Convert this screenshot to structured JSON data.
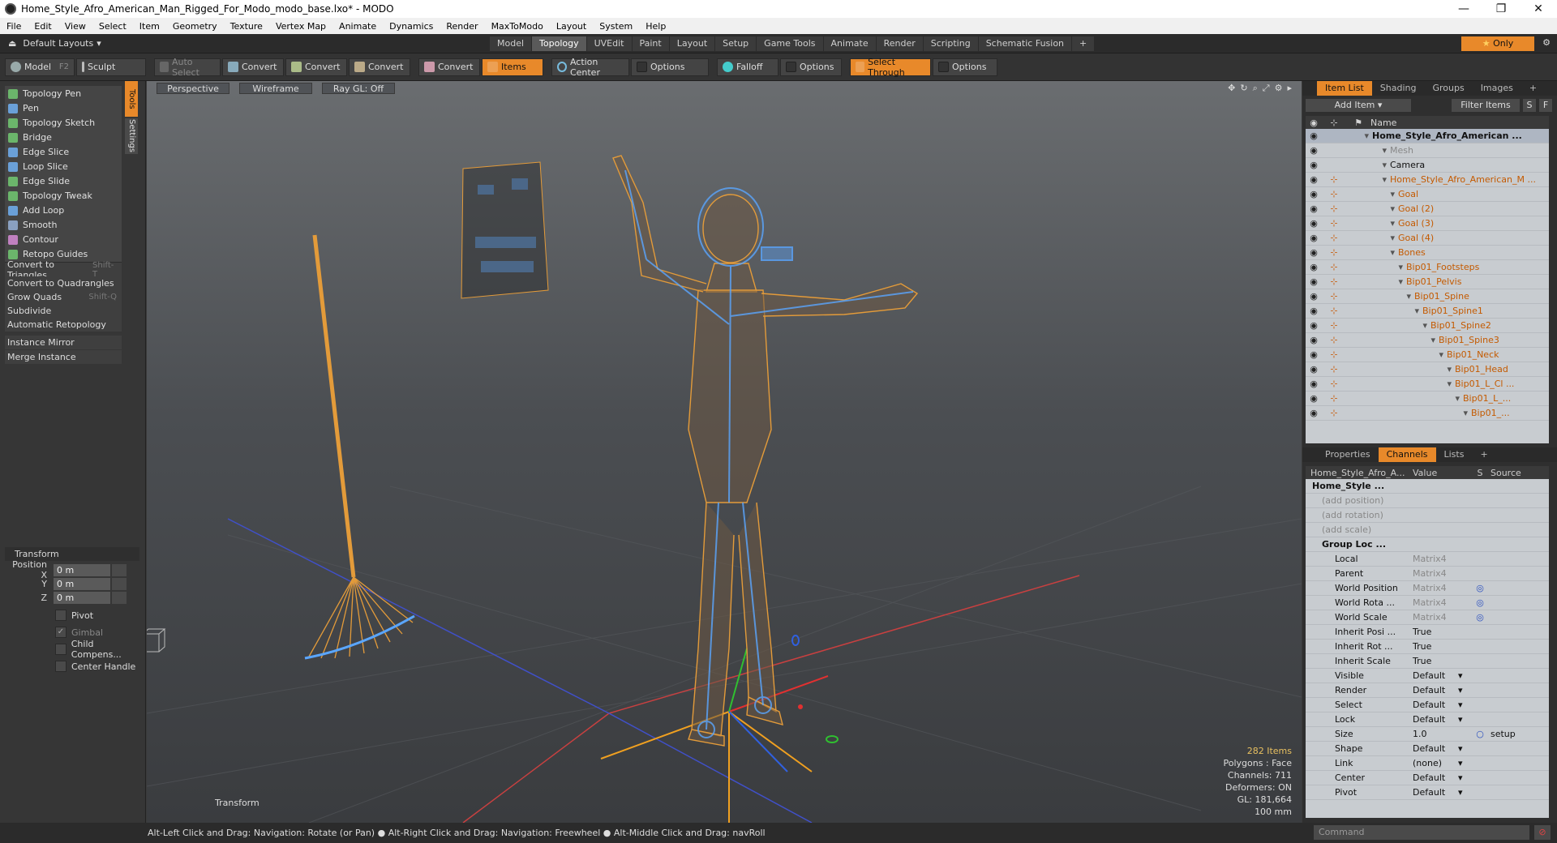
{
  "window": {
    "title": "Home_Style_Afro_American_Man_Rigged_For_Modo_modo_base.lxo* - MODO",
    "min": "—",
    "max": "❐",
    "close": "✕"
  },
  "menu": [
    "File",
    "Edit",
    "View",
    "Select",
    "Item",
    "Geometry",
    "Texture",
    "Vertex Map",
    "Animate",
    "Dynamics",
    "Render",
    "MaxToModo",
    "Layout",
    "System",
    "Help"
  ],
  "layouts": {
    "default_label": "Default Layouts",
    "tabs": [
      "Model",
      "Topology",
      "UVEdit",
      "Paint",
      "Layout",
      "Setup",
      "Game Tools",
      "Animate",
      "Render",
      "Scripting",
      "Schematic Fusion"
    ],
    "active_tab": "Topology",
    "only_label": "Only"
  },
  "toolbar": {
    "mode_model": "Model",
    "mode_key": "F2",
    "mode_sculpt": "Sculpt",
    "auto_select": "Auto Select",
    "convert1": "Convert",
    "convert2": "Convert",
    "convert3": "Convert",
    "convert4": "Convert",
    "items": "Items",
    "action_center": "Action Center",
    "options1": "Options",
    "falloff": "Falloff",
    "options2": "Options",
    "select_through": "Select Through",
    "options3": "Options"
  },
  "left_tabs": {
    "tools": "Tools",
    "settings": "Settings"
  },
  "tools": [
    {
      "label": "Topology Pen",
      "color": "#6bb56b"
    },
    {
      "label": "Pen",
      "color": "#6aa0d8"
    },
    {
      "label": "Topology Sketch",
      "color": "#6bb56b"
    },
    {
      "label": "Bridge",
      "color": "#6bb56b"
    },
    {
      "label": "Edge Slice",
      "color": "#6aa0d8"
    },
    {
      "label": "Loop Slice",
      "color": "#6aa0d8"
    },
    {
      "label": "Edge Slide",
      "color": "#6bb56b"
    },
    {
      "label": "Topology Tweak",
      "color": "#6bb56b"
    },
    {
      "label": "Add Loop",
      "color": "#6aa0d8"
    },
    {
      "label": "Smooth",
      "color": "#8aa0c0"
    },
    {
      "label": "Contour",
      "color": "#c080c0"
    },
    {
      "label": "Retopo Guides",
      "color": "#6bb56b"
    }
  ],
  "commands": [
    {
      "label": "Convert to Triangles",
      "shortcut": "Shift-T"
    },
    {
      "label": "Convert to Quadrangles",
      "shortcut": ""
    },
    {
      "label": "Grow Quads",
      "shortcut": "Shift-Q"
    },
    {
      "label": "Subdivide",
      "shortcut": ""
    },
    {
      "label": "Automatic Retopology",
      "shortcut": ""
    }
  ],
  "instance_commands": [
    "Instance Mirror",
    "Merge Instance"
  ],
  "transform": {
    "header": "Transform",
    "pos_x_label": "Position X",
    "y_label": "Y",
    "z_label": "Z",
    "x": "0 m",
    "y": "0 m",
    "z": "0 m",
    "pivot": "Pivot",
    "gimbal": "Gimbal",
    "child_comp": "Child Compens...",
    "center_handle": "Center Handle"
  },
  "viewport": {
    "perspective": "Perspective",
    "wireframe": "Wireframe",
    "raygl": "Ray GL: Off",
    "label": "Transform",
    "stats": {
      "items": "282 Items",
      "polygons": "Polygons : Face",
      "channels": "Channels: 711",
      "deformers": "Deformers: ON",
      "gl": "GL: 181,664",
      "scale": "100 mm"
    }
  },
  "item_panel": {
    "tabs": [
      "Item List",
      "Shading",
      "Groups",
      "Images"
    ],
    "add_item": "Add Item",
    "filter_items": "Filter Items",
    "s": "S",
    "f": "F",
    "col_name": "Name",
    "rows": [
      {
        "indent": 68,
        "name": "Home_Style_Afro_American ...",
        "style": "sel",
        "lock": ""
      },
      {
        "indent": 90,
        "name": "Mesh",
        "style": "grey",
        "lock": ""
      },
      {
        "indent": 90,
        "name": "Camera",
        "style": "",
        "lock": ""
      },
      {
        "indent": 90,
        "name": "Home_Style_Afro_American_M ...",
        "style": "orange",
        "lock": "⊹"
      },
      {
        "indent": 100,
        "name": "Goal",
        "style": "orange",
        "lock": "⊹"
      },
      {
        "indent": 100,
        "name": "Goal (2)",
        "style": "orange",
        "lock": "⊹"
      },
      {
        "indent": 100,
        "name": "Goal (3)",
        "style": "orange",
        "lock": "⊹"
      },
      {
        "indent": 100,
        "name": "Goal (4)",
        "style": "orange",
        "lock": "⊹"
      },
      {
        "indent": 100,
        "name": "Bones",
        "style": "orange",
        "lock": "⊹"
      },
      {
        "indent": 110,
        "name": "Bip01_Footsteps",
        "style": "orange",
        "lock": "⊹"
      },
      {
        "indent": 110,
        "name": "Bip01_Pelvis",
        "style": "orange",
        "lock": "⊹"
      },
      {
        "indent": 120,
        "name": "Bip01_Spine",
        "style": "orange",
        "lock": "⊹"
      },
      {
        "indent": 130,
        "name": "Bip01_Spine1",
        "style": "orange",
        "lock": "⊹"
      },
      {
        "indent": 140,
        "name": "Bip01_Spine2",
        "style": "orange",
        "lock": "⊹"
      },
      {
        "indent": 150,
        "name": "Bip01_Spine3",
        "style": "orange",
        "lock": "⊹"
      },
      {
        "indent": 160,
        "name": "Bip01_Neck",
        "style": "orange",
        "lock": "⊹"
      },
      {
        "indent": 170,
        "name": "Bip01_Head",
        "style": "orange",
        "lock": "⊹"
      },
      {
        "indent": 170,
        "name": "Bip01_L_Cl ...",
        "style": "orange",
        "lock": "⊹"
      },
      {
        "indent": 180,
        "name": "Bip01_L_...",
        "style": "orange",
        "lock": "⊹"
      },
      {
        "indent": 190,
        "name": "Bip01_...",
        "style": "orange",
        "lock": "⊹"
      }
    ]
  },
  "channel_panel": {
    "tabs": [
      "Properties",
      "Channels",
      "Lists"
    ],
    "col_name": "Home_Style_Afro_A...",
    "col_value": "Value",
    "col_s": "S",
    "col_source": "Source",
    "rows": [
      {
        "name": "Home_Style ...",
        "value": "",
        "s": "",
        "source": "",
        "style": "bold",
        "indent": 8
      },
      {
        "name": "(add position)",
        "value": "",
        "s": "",
        "source": "",
        "style": "grey",
        "indent": 20
      },
      {
        "name": "(add rotation)",
        "value": "",
        "s": "",
        "source": "",
        "style": "grey",
        "indent": 20
      },
      {
        "name": "(add scale)",
        "value": "",
        "s": "",
        "source": "",
        "style": "grey",
        "indent": 20
      },
      {
        "name": "Group Loc ...",
        "value": "",
        "s": "",
        "source": "",
        "style": "bold",
        "indent": 20
      },
      {
        "name": "Local",
        "value": "Matrix4",
        "s": "",
        "source": "",
        "style": "dimv",
        "indent": 36
      },
      {
        "name": "Parent",
        "value": "Matrix4",
        "s": "",
        "source": "",
        "style": "dimv",
        "indent": 36
      },
      {
        "name": "World Position",
        "value": "Matrix4",
        "s": "◎",
        "source": "",
        "style": "dimv",
        "indent": 36
      },
      {
        "name": "World Rota ...",
        "value": "Matrix4",
        "s": "◎",
        "source": "",
        "style": "dimv",
        "indent": 36
      },
      {
        "name": "World Scale",
        "value": "Matrix4",
        "s": "◎",
        "source": "",
        "style": "dimv",
        "indent": 36
      },
      {
        "name": "Inherit Posi ...",
        "value": "True",
        "s": "",
        "source": "",
        "style": "",
        "indent": 36
      },
      {
        "name": "Inherit Rot ...",
        "value": "True",
        "s": "",
        "source": "",
        "style": "",
        "indent": 36
      },
      {
        "name": "Inherit Scale",
        "value": "True",
        "s": "",
        "source": "",
        "style": "",
        "indent": 36
      },
      {
        "name": "Visible",
        "value": "Default",
        "s": "",
        "source": "",
        "style": "dd",
        "indent": 36
      },
      {
        "name": "Render",
        "value": "Default",
        "s": "",
        "source": "",
        "style": "dd",
        "indent": 36
      },
      {
        "name": "Select",
        "value": "Default",
        "s": "",
        "source": "",
        "style": "dd",
        "indent": 36
      },
      {
        "name": "Lock",
        "value": "Default",
        "s": "",
        "source": "",
        "style": "dd",
        "indent": 36
      },
      {
        "name": "Size",
        "value": "1.0",
        "s": "○",
        "source": "setup",
        "style": "",
        "indent": 36
      },
      {
        "name": "Shape",
        "value": "Default",
        "s": "",
        "source": "",
        "style": "dd",
        "indent": 36
      },
      {
        "name": "Link",
        "value": "(none)",
        "s": "",
        "source": "",
        "style": "dd",
        "indent": 36
      },
      {
        "name": "Center",
        "value": "Default",
        "s": "",
        "source": "",
        "style": "dd",
        "indent": 36
      },
      {
        "name": "Pivot",
        "value": "Default",
        "s": "",
        "source": "",
        "style": "dd",
        "indent": 36
      }
    ]
  },
  "statusbar": {
    "hint": "Alt-Left Click and Drag: Navigation: Rotate (or Pan) ● Alt-Right Click and Drag: Navigation: Freewheel ● Alt-Middle Click and Drag: navRoll",
    "command_placeholder": "Command"
  },
  "colors": {
    "accent": "#e8892a",
    "wire": "#e39b3a",
    "select": "#5aa6ff"
  }
}
